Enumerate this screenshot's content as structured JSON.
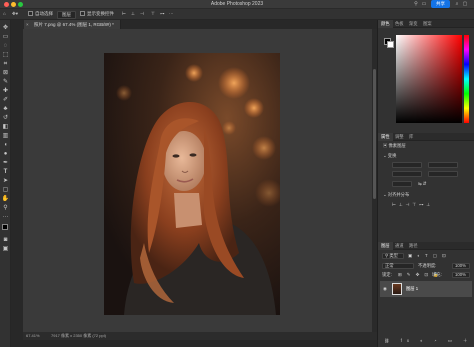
{
  "window": {
    "title": "Adobe Photoshop 2023",
    "share_label": "共享"
  },
  "options_bar": {
    "auto_select_label": "自动选择",
    "auto_select_mode": "图层",
    "show_transform_label": "显示变换控件"
  },
  "document": {
    "tab_label": "照片 7.png @ 67.4% (图层 1, RGB/8#) *",
    "zoom_status": "67.41%",
    "size_status": "7917 像素 x 2350 像素 (72 ppi)"
  },
  "color_panel": {
    "tabs": [
      "颜色",
      "色板",
      "渐变",
      "图案"
    ]
  },
  "properties_panel": {
    "tabs": [
      "属性",
      "调整",
      "库"
    ],
    "section_label": "像素图层",
    "transform_label": "变换",
    "align_label": "对齐并分布"
  },
  "layers_panel": {
    "tabs": [
      "图层",
      "通道",
      "路径"
    ],
    "kind_label": "类型",
    "blend_mode": "正常",
    "opacity_label": "不透明度:",
    "opacity_value": "100%",
    "lock_label": "锁定:",
    "fill_label": "填充:",
    "fill_value": "100%",
    "layers": [
      {
        "name": "图层 1",
        "visible": true,
        "selected": true
      }
    ]
  },
  "colors": {
    "accent": "#1473e6",
    "foreground": "#000000",
    "background": "#ffffff",
    "hue": "#ff0000"
  }
}
